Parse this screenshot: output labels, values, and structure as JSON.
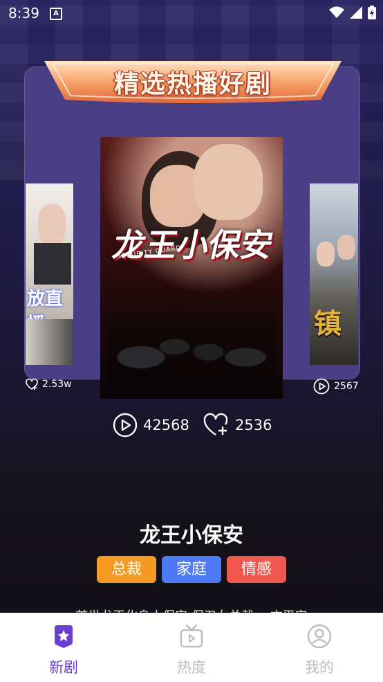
{
  "status_bar": {
    "time": "8:39",
    "notification_icon": "A"
  },
  "banner": {
    "title": "精选热播好剧"
  },
  "carousel": {
    "left": {
      "overlay_text": "放直播",
      "plays": "2.53w"
    },
    "main": {
      "title_art": "龙王小保安",
      "subtitle_art": "SECURITY GUARD"
    },
    "right": {
      "overlay_text": "镇",
      "plays": "2567"
    }
  },
  "stats": {
    "plays": "42568",
    "likes": "2536"
  },
  "drama": {
    "title": "龙王小保安",
    "tags": [
      {
        "label": "总裁",
        "color": "#f59a23"
      },
      {
        "label": "家庭",
        "color": "#4f7af6"
      },
      {
        "label": "情感",
        "color": "#f0574f"
      }
    ],
    "description": "首世龙王化身小保安 保卫女总裁 一方平安"
  },
  "tabs": [
    {
      "label": "新剧",
      "icon": "star-badge-icon",
      "active": true,
      "color": "#6a3fd1"
    },
    {
      "label": "热度",
      "icon": "tv-icon",
      "active": false,
      "color": "#bdbdbd"
    },
    {
      "label": "我的",
      "icon": "user-circle-icon",
      "active": false,
      "color": "#bdbdbd"
    }
  ]
}
